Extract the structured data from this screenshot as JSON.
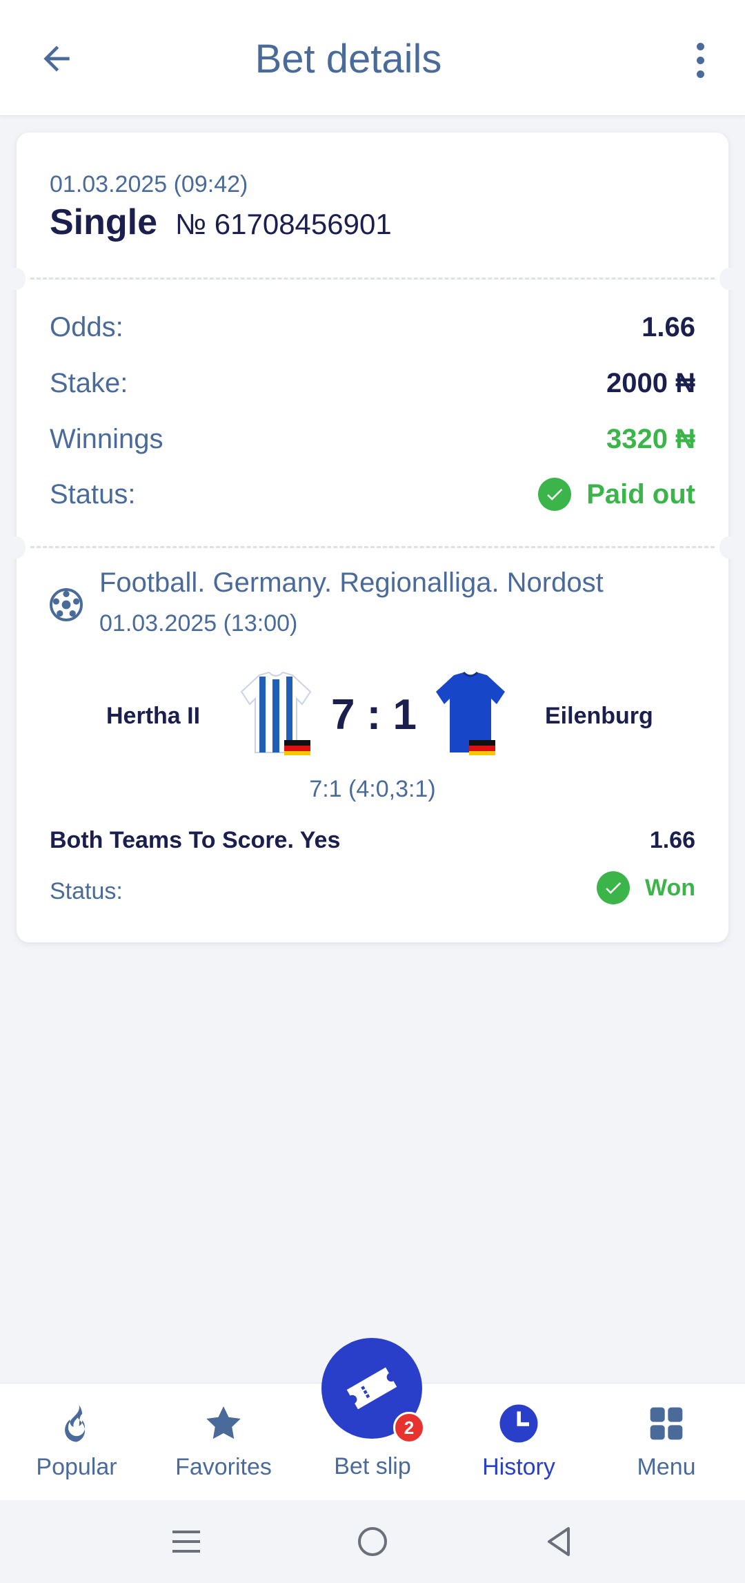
{
  "header": {
    "title": "Bet details",
    "back_icon": "arrow-left-icon",
    "more_icon": "more-vertical-icon"
  },
  "bet": {
    "date": "01.03.2025 (09:42)",
    "type": "Single",
    "number": "№ 61708456901",
    "odds_label": "Odds:",
    "odds_value": "1.66",
    "stake_label": "Stake:",
    "stake_value": "2000 ₦",
    "winnings_label": "Winnings",
    "winnings_value": "3320 ₦",
    "status_label": "Status:",
    "status_value": "Paid out"
  },
  "event": {
    "sport_icon": "football-icon",
    "league": "Football. Germany. Regionalliga. Nordost",
    "date": "01.03.2025 (13:00)",
    "home_team": "Hertha II",
    "away_team": "Eilenburg",
    "score": "7 : 1",
    "score_detail": "7:1 (4:0,3:1)",
    "market": "Both Teams To Score. Yes",
    "market_odds": "1.66",
    "status_label": "Status:",
    "status_value": "Won"
  },
  "nav": {
    "items": [
      {
        "label": "Popular",
        "icon": "flame-icon"
      },
      {
        "label": "Favorites",
        "icon": "star-icon"
      },
      {
        "label": "Bet slip",
        "icon": "ticket-icon"
      },
      {
        "label": "History",
        "icon": "clock-icon"
      },
      {
        "label": "Menu",
        "icon": "grid-icon"
      }
    ],
    "active": "History",
    "betslip_badge": "2"
  },
  "colors": {
    "accent": "#2a3fc9",
    "text_muted": "#4a6b9a",
    "text_dark": "#1a1f4e",
    "success": "#3bb54a",
    "badge": "#e8322e"
  }
}
